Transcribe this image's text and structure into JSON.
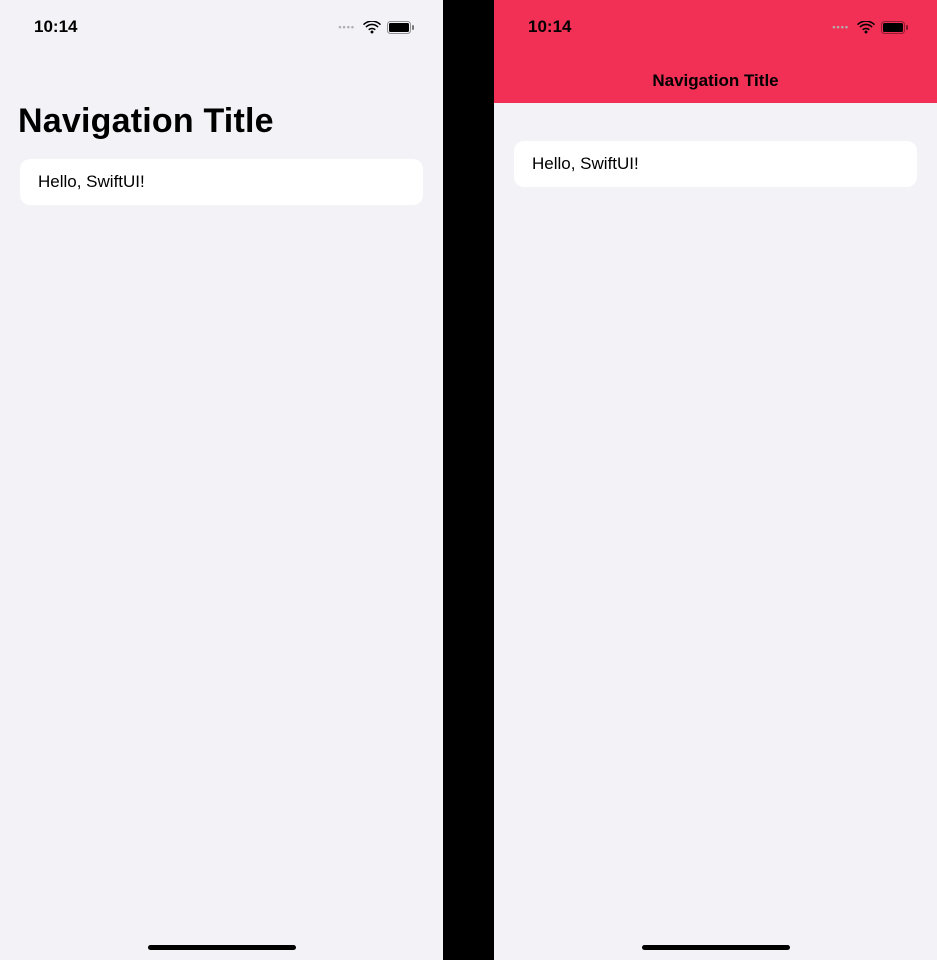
{
  "left": {
    "status": {
      "time": "10:14"
    },
    "nav": {
      "title": "Navigation Title"
    },
    "list": {
      "row1": "Hello, SwiftUI!"
    }
  },
  "right": {
    "status": {
      "time": "10:14"
    },
    "nav": {
      "title": "Navigation Title",
      "bg_color": "#f23055"
    },
    "list": {
      "row1": "Hello, SwiftUI!"
    }
  }
}
